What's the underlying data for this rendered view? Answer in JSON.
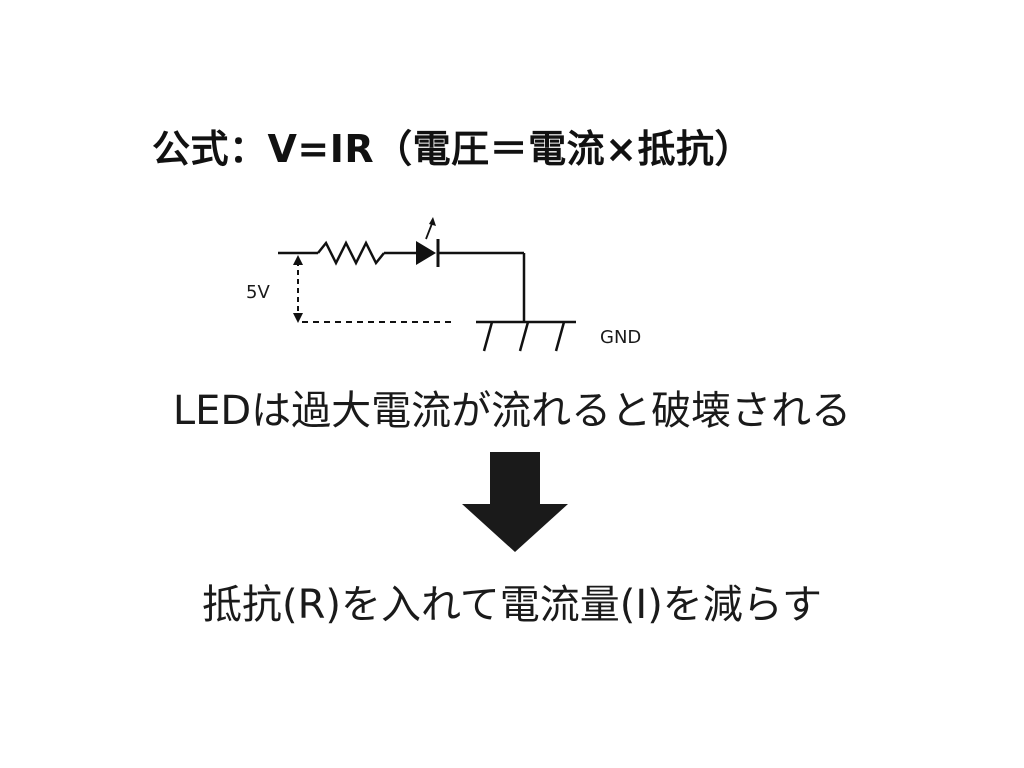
{
  "slide": {
    "title": "公式：V=IR（電圧＝電流×抵抗）",
    "diagram": {
      "voltage_label": "5V",
      "ground_label": "GND",
      "icons": [
        "resistor-icon",
        "led-icon",
        "ground-symbol-icon",
        "voltage-arrow-icon"
      ]
    },
    "statement": "LEDは過大電流が流れると破壊される",
    "arrow_icon": "down-arrow-icon",
    "result": "抵抗(R)を入れて電流量(I)を減らす"
  }
}
